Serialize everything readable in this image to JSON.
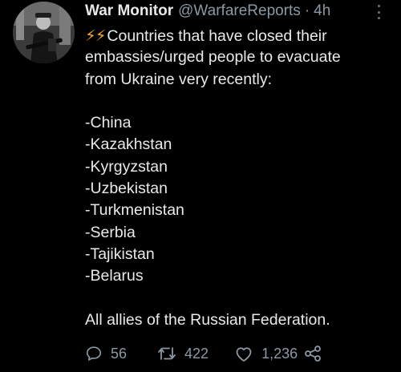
{
  "tweet": {
    "author": {
      "display_name": "War Monitor",
      "handle": "@WarfareReports",
      "separator": "·",
      "time": "4h"
    },
    "body": {
      "bolts": "⚡⚡",
      "lines": [
        "Countries that have closed their",
        "embassies/urged people to evacuate",
        "from Ukraine very recently:"
      ],
      "countries": [
        "-China",
        "-Kazakhstan",
        "-Kyrgyzstan",
        "-Uzbekistan",
        "-Turkmenistan",
        "-Serbia",
        "-Tajikistan",
        "-Belarus"
      ],
      "closing": "All allies of the Russian Federation."
    },
    "actions": {
      "replies": "56",
      "retweets": "422",
      "likes": "1,236"
    },
    "icons": [
      "more-icon",
      "reply-icon",
      "retweet-icon",
      "like-icon",
      "share-icon"
    ],
    "colors": {
      "background": "#000000",
      "text": "#e7e9ea",
      "muted": "#8b98a5",
      "emoji": "#ffac33"
    }
  }
}
